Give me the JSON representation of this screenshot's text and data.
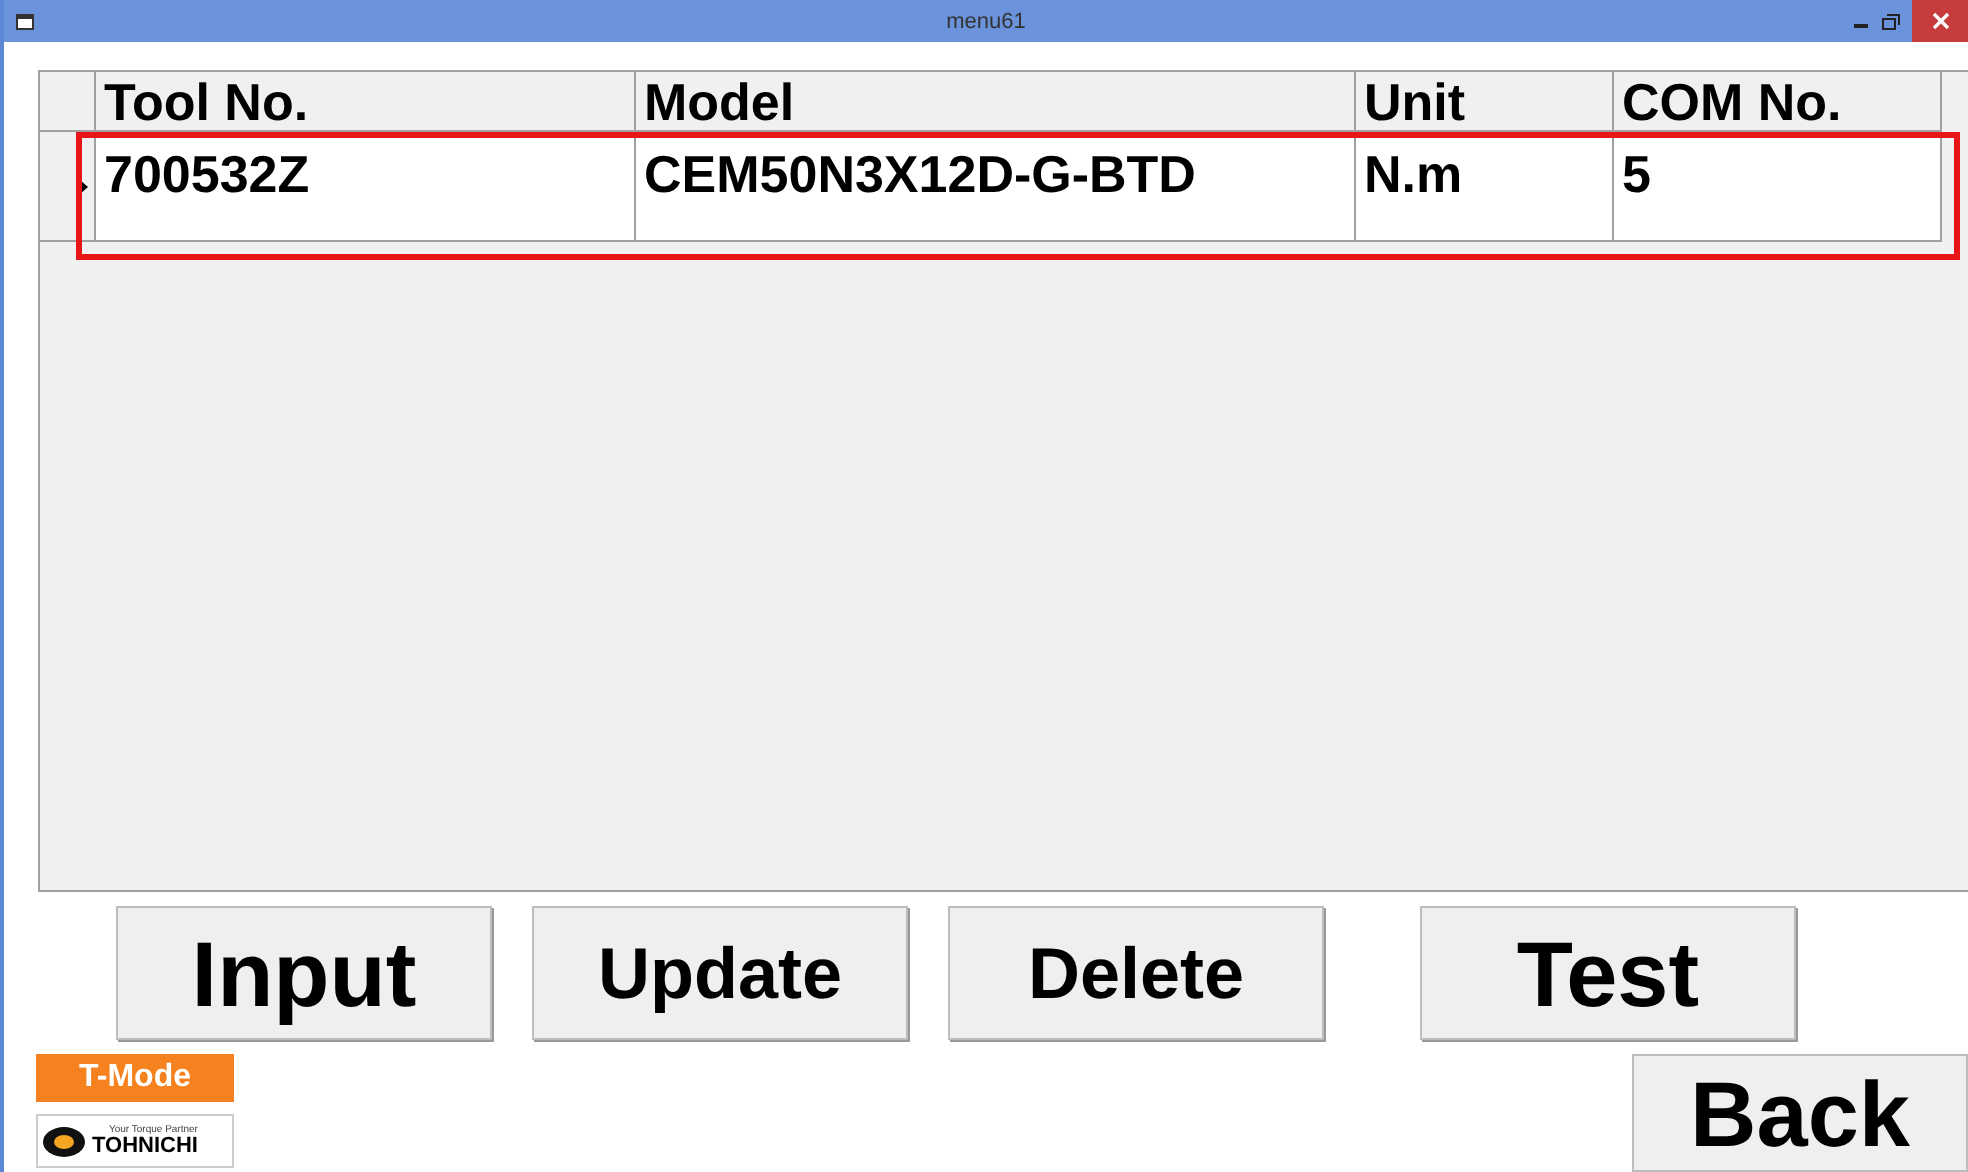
{
  "window": {
    "title": "menu61"
  },
  "table": {
    "columns": [
      "Tool No.",
      "Model",
      "Unit",
      "COM No."
    ],
    "rows": [
      {
        "selected": true,
        "cells": [
          "700532Z",
          "CEM50N3X12D-G-BTD",
          "N.m",
          "5"
        ]
      }
    ]
  },
  "buttons": [
    {
      "label": "Input",
      "kind": "large"
    },
    {
      "label": "Update",
      "kind": "medium"
    },
    {
      "label": "Delete",
      "kind": "medium"
    },
    {
      "label": "Test",
      "kind": "large"
    }
  ],
  "mode_badge": "T-Mode",
  "logo": {
    "tagline": "Your Torque Partner",
    "brand": "TOHNICHI"
  },
  "back_button": "Back"
}
